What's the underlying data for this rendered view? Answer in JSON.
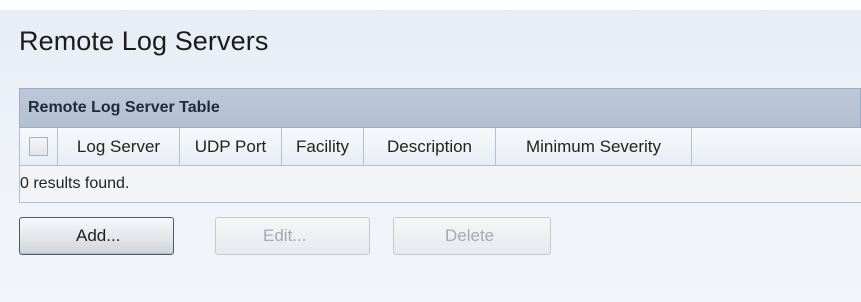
{
  "page": {
    "title": "Remote Log Servers"
  },
  "table": {
    "title": "Remote Log Server Table",
    "columns": [
      "Log Server",
      "UDP Port",
      "Facility",
      "Description",
      "Minimum Severity"
    ],
    "results_text": "0 results found."
  },
  "buttons": {
    "add_label": "Add...",
    "edit_label": "Edit...",
    "delete_label": "Delete"
  },
  "colors": {
    "header_bg": "#b9c5d7",
    "page_bg": "#edf1f8",
    "disabled_text": "#a4a9b1"
  }
}
